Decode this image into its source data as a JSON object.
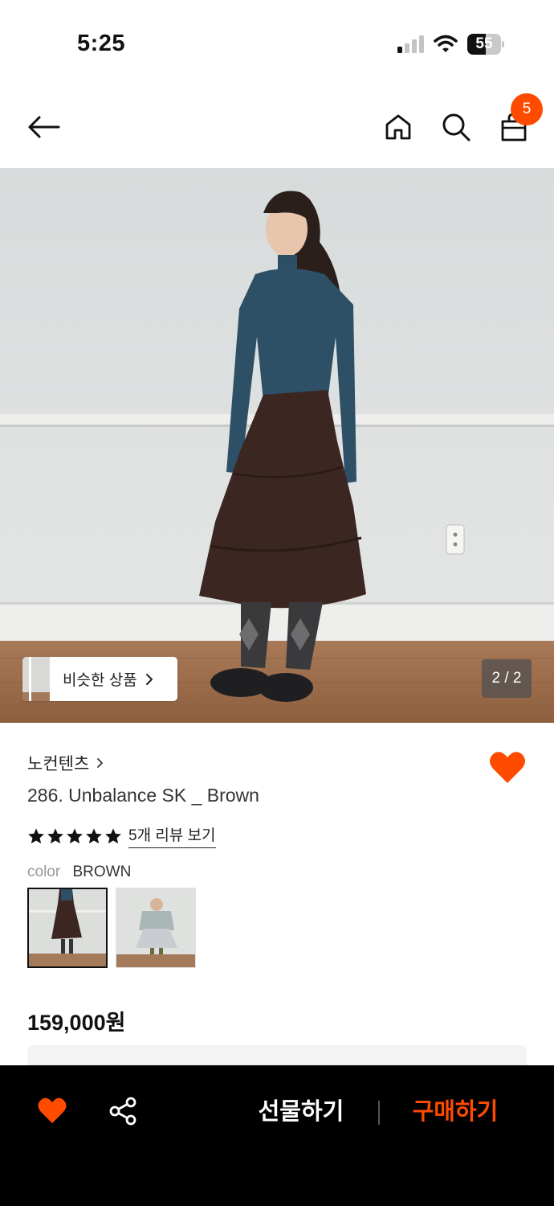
{
  "status_bar": {
    "time": "5:25",
    "battery_level": "55",
    "battery_fraction": 0.55
  },
  "nav": {
    "cart_count": "5"
  },
  "hero": {
    "similar_label": "비슷한 상품",
    "page_indicator": "2 / 2"
  },
  "product": {
    "brand": "노컨텐츠",
    "name": "286. Unbalance SK _ Brown",
    "rating": 5,
    "review_link": "5개 리뷰 보기",
    "color_label": "color",
    "color_value": "BROWN",
    "price": "159,000원"
  },
  "colors": {
    "accent": "#ff4b00",
    "bottom_bar_bg": "#000000"
  },
  "bottom_bar": {
    "gift_label": "선물하기",
    "buy_label": "구매하기"
  }
}
